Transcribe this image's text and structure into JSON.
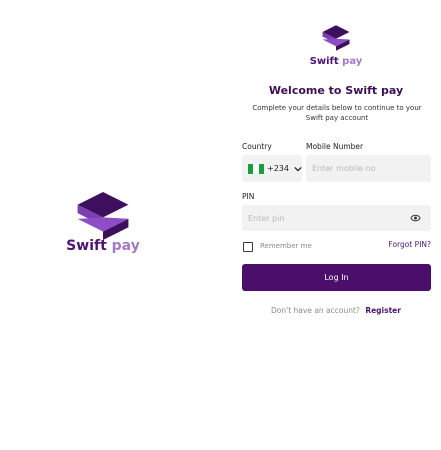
{
  "brand": {
    "name_a": "Swift",
    "name_b": " pay",
    "primary_color": "#4b1570",
    "secondary_color": "#a679c7"
  },
  "form": {
    "title": "Welcome to Swift pay",
    "subtitle": "Complete your details below to continue to your Swift pay account",
    "country_label": "Country",
    "dial_code": "+234",
    "country_flag": "nigeria-flag-icon",
    "mobile_label": "Mobile Number",
    "mobile_placeholder": "Enter mobile no",
    "mobile_value": "",
    "pin_label": "PIN",
    "pin_placeholder": "Enter pin",
    "pin_value": "",
    "remember_label": "Remember me",
    "remember_checked": false,
    "forgot_label": "Forgot PIN?",
    "login_label": "Log In",
    "register_question": "Don't have an account?",
    "register_label": "Register",
    "button_color": "#4b0f6b"
  },
  "icons": {
    "logo": "swift-pay-logo-icon",
    "dropdown": "chevron-down-icon",
    "show_pin": "eye-icon"
  }
}
